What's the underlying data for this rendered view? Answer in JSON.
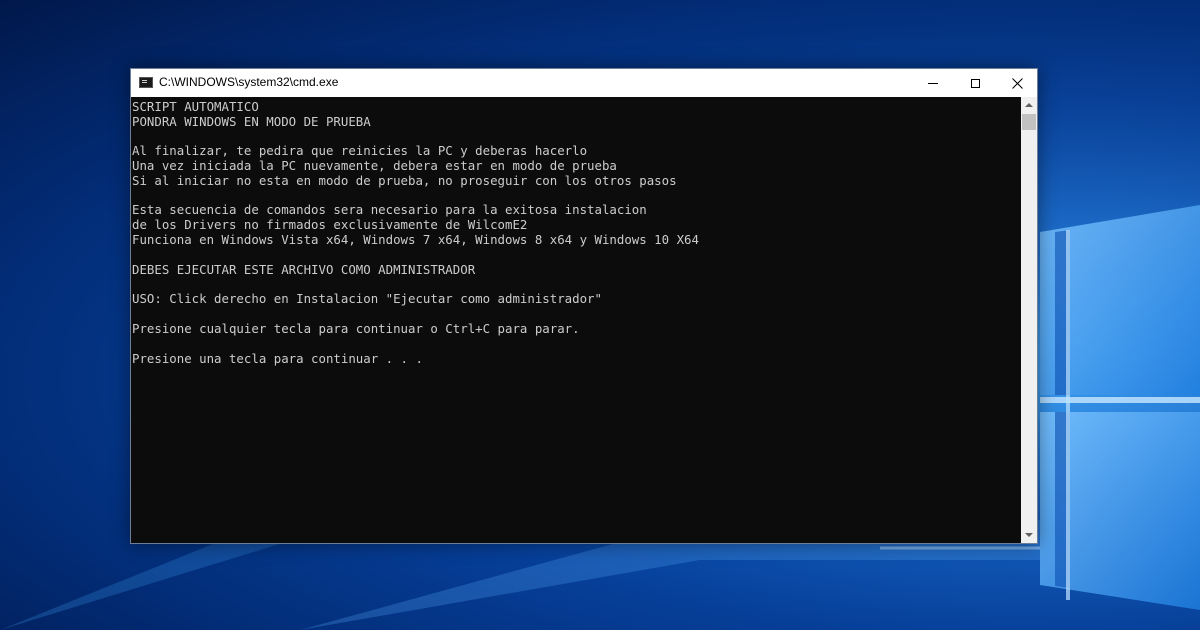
{
  "window": {
    "title": "C:\\WINDOWS\\system32\\cmd.exe",
    "icon": "cmd-icon",
    "controls": {
      "minimize_icon": "minimize-icon",
      "maximize_icon": "maximize-icon",
      "close_glyph": "✕"
    }
  },
  "console": {
    "lines": [
      "SCRIPT AUTOMATICO",
      "PONDRA WINDOWS EN MODO DE PRUEBA",
      "",
      "Al finalizar, te pedira que reinicies la PC y deberas hacerlo",
      "Una vez iniciada la PC nuevamente, debera estar en modo de prueba",
      "Si al iniciar no esta en modo de prueba, no proseguir con los otros pasos",
      "",
      "Esta secuencia de comandos sera necesario para la exitosa instalacion",
      "de los Drivers no firmados exclusivamente de WilcomE2",
      "Funciona en Windows Vista x64, Windows 7 x64, Windows 8 x64 y Windows 10 X64",
      "",
      "DEBES EJECUTAR ESTE ARCHIVO COMO ADMINISTRADOR",
      "",
      "USO: Click derecho en Instalacion \"Ejecutar como administrador\"",
      "",
      "Presione cualquier tecla para continuar o Ctrl+C para parar.",
      "",
      "Presione una tecla para continuar . . ."
    ]
  },
  "colors": {
    "console_bg": "#0c0c0c",
    "console_text": "#cccccc",
    "wallpaper_accent": "#0d5fc4"
  }
}
